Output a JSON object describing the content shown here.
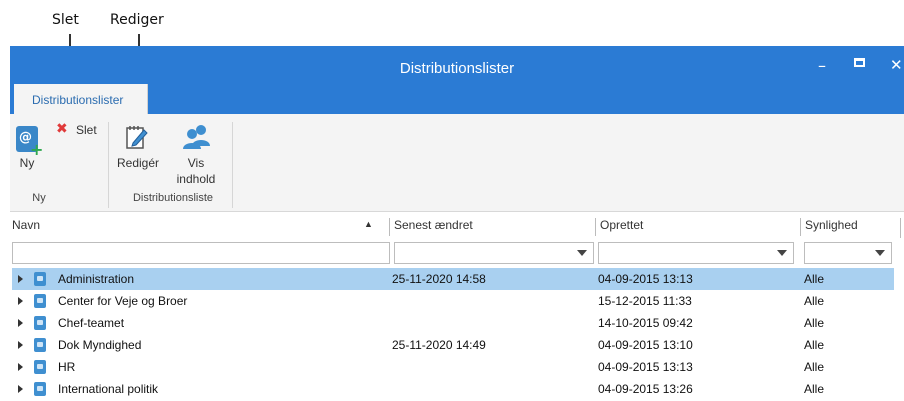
{
  "annotations": {
    "delete": "Slet",
    "edit": "Rediger"
  },
  "window": {
    "title": "Distributionslister",
    "controls": {
      "minimize": "–",
      "close": "✕"
    },
    "ribbon_collapse": "⌃"
  },
  "ribbon": {
    "tab": "Distributionslister",
    "groups": {
      "new": {
        "label": "Ny",
        "buttons": {
          "new": "Ny",
          "delete": "Slet"
        }
      },
      "list": {
        "label": "Distributionsliste",
        "buttons": {
          "edit": "Redigér",
          "view_line1": "Vis",
          "view_line2": "indhold"
        }
      }
    }
  },
  "grid": {
    "columns": {
      "name": "Navn",
      "modified": "Senest ændret",
      "created": "Oprettet",
      "visibility": "Synlighed"
    },
    "sort": {
      "column": "name",
      "direction": "ascending"
    },
    "rows": [
      {
        "name": "Administration",
        "modified": "25-11-2020 14:58",
        "created": "04-09-2015 13:13",
        "visibility": "Alle"
      },
      {
        "name": "Center for Veje og Broer",
        "modified": "",
        "created": "15-12-2015 11:33",
        "visibility": "Alle"
      },
      {
        "name": "Chef-teamet",
        "modified": "",
        "created": "14-10-2015 09:42",
        "visibility": "Alle"
      },
      {
        "name": "Dok Myndighed",
        "modified": "25-11-2020 14:49",
        "created": "04-09-2015 13:10",
        "visibility": "Alle"
      },
      {
        "name": "HR",
        "modified": "",
        "created": "04-09-2015 13:13",
        "visibility": "Alle"
      },
      {
        "name": "International politik",
        "modified": "",
        "created": "04-09-2015 13:26",
        "visibility": "Alle"
      }
    ],
    "selected_row": "Administration"
  },
  "colors": {
    "titlebar": "#2b7bd4",
    "selection": "#a9d0f0",
    "delete_icon": "#e03a3a"
  }
}
